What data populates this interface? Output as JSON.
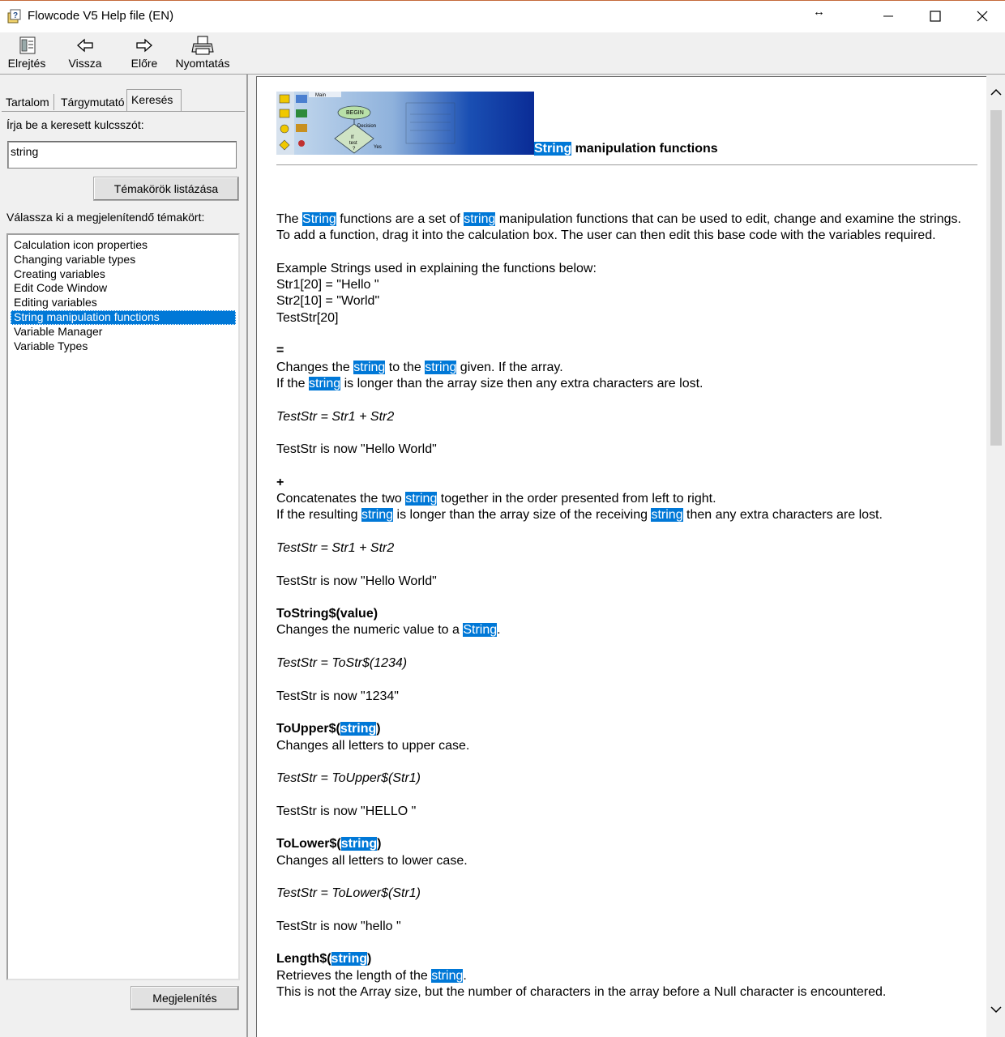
{
  "window": {
    "title": "Flowcode V5 Help file (EN)"
  },
  "toolbar": {
    "hide_label": "Elrejtés",
    "back_label": "Vissza",
    "forward_label": "Előre",
    "print_label": "Nyomtatás"
  },
  "left": {
    "tabs": {
      "contents": "Tartalom",
      "index": "Tárgymutató",
      "search": "Keresés"
    },
    "keyword_prompt": "Írja be a keresett kulcsszót:",
    "search_value": "string",
    "list_topics_button": "Témakörök listázása",
    "select_prompt": "Válassza ki a megjelenítendő témakört:",
    "topics": [
      "Calculation icon properties",
      "Changing variable types",
      "Creating variables",
      "Edit Code Window",
      "Editing variables",
      "String manipulation functions",
      "Variable Manager",
      "Variable Types"
    ],
    "selected_topic_index": 5,
    "display_button": "Megjelenítés"
  },
  "content": {
    "banner": {
      "tab_label": "Main",
      "begin": "BEGIN",
      "decision": "Decision",
      "if": "If",
      "test": "test",
      "q": "?",
      "yes": "Yes"
    },
    "title_hl": "String",
    "title_rest": " manipulation functions",
    "intro": {
      "p1": "The ",
      "h1": "String",
      "p2": " functions are a set of ",
      "h2": "string",
      "p3": " manipulation functions that can be used to edit, change and examine the strings.",
      "line2": "To add a function, drag it into the calculation box. The user can then edit this base code with the variables required."
    },
    "examples": {
      "heading": "Example Strings used in explaining the functions below:",
      "l1": "Str1[20] = \"Hello \"",
      "l2": "Str2[10] = \"World\"",
      "l3": "TestStr[20]"
    },
    "assign": {
      "symbol": "=",
      "a1": "Changes the ",
      "h1": "string",
      "a2": " to the ",
      "h2": "string",
      "a3": " given. If the  array.",
      "b1": "If the ",
      "h3": "string",
      "b2": " is longer than the array size then any extra characters are lost.",
      "example": "TestStr = Str1 + Str2",
      "result": "TestStr is now \"Hello World\""
    },
    "concat": {
      "symbol": "+",
      "a1": "Concatenates the two ",
      "h1": "string",
      "a2": " together in the order presented from left to right.",
      "b1": "If the resulting ",
      "h2": "string",
      "b2": " is longer than the array size of the receiving ",
      "h3": "string",
      "b3": " then any extra characters are lost.",
      "example": "TestStr = Str1 + Str2",
      "result": "TestStr is now \"Hello World\""
    },
    "tostring": {
      "name": "ToString$(value)",
      "d1": "Changes the numeric value to a ",
      "h1": "String",
      "d2": ".",
      "example": "TestStr = ToStr$(1234)",
      "result": "TestStr is now \"1234\""
    },
    "toupper": {
      "name1": "ToUpper$(",
      "h1": "string",
      "name2": ")",
      "desc": "Changes all letters to upper case.",
      "example": "TestStr = ToUpper$(Str1)",
      "result": "TestStr is now \"HELLO \""
    },
    "tolower": {
      "name1": "ToLower$(",
      "h1": "string",
      "name2": ")",
      "desc": "Changes all letters to lower case.",
      "example": "TestStr = ToLower$(Str1)",
      "result": "TestStr is now \"hello \""
    },
    "length": {
      "name1": "Length$(",
      "h1": "string",
      "name2": ")",
      "d1": "Retrieves the length of the ",
      "h2": "string",
      "d2": ".",
      "d3": "This is not the Array size, but the number of characters in the array before a Null character is encountered."
    }
  }
}
